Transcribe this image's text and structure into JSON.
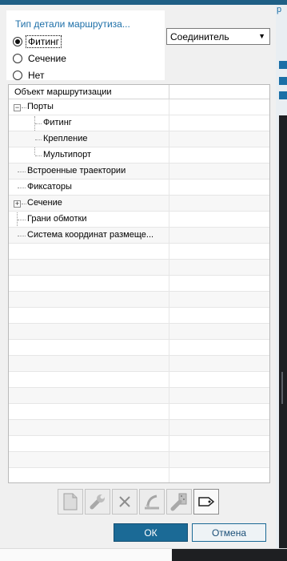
{
  "background": {
    "peek_title": "р"
  },
  "part_type": {
    "title": "Тип детали маршрутиза...",
    "options": [
      {
        "label": "Фитинг",
        "selected": true
      },
      {
        "label": "Сечение",
        "selected": false
      },
      {
        "label": "Нет",
        "selected": false
      }
    ]
  },
  "connector_combo": {
    "value": "Соединитель",
    "arrow": "▼"
  },
  "tree": {
    "header": "Объект маршрутизации",
    "nodes": [
      {
        "label": "Порты",
        "expander": "−"
      },
      {
        "label": "Фитинг"
      },
      {
        "label": "Крепление"
      },
      {
        "label": "Мультипорт"
      },
      {
        "label": "Встроенные траектории"
      },
      {
        "label": "Фиксаторы"
      },
      {
        "label": "Сечение",
        "expander": "+"
      },
      {
        "label": "Грани обмотки"
      },
      {
        "label": "Система координат размеще..."
      }
    ]
  },
  "toolbar": {
    "icons": [
      "new-document-icon",
      "wrench-icon",
      "delete-icon",
      "route-icon",
      "component-icon",
      "tag-icon"
    ],
    "active_icon": "tag-icon"
  },
  "buttons": {
    "ok": "ОК",
    "cancel": "Отмена"
  },
  "colors": {
    "accent": "#1b6a96",
    "title_blue": "#1d6fa8"
  }
}
